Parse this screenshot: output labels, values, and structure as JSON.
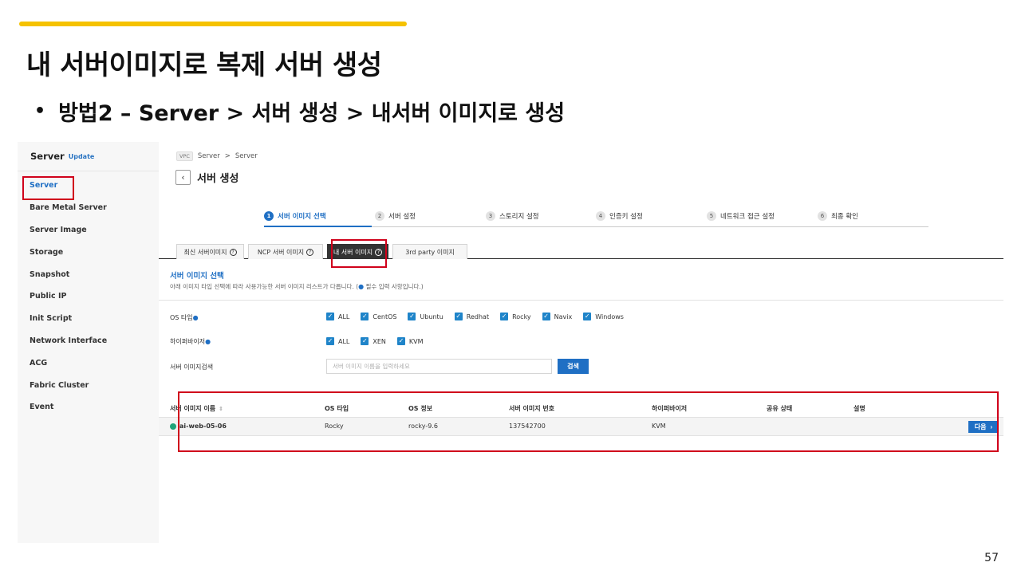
{
  "slide": {
    "title": "내 서버이미지로 복제 서버 생성",
    "bullet": "방법2 – Server > 서버 생성 > 내서버 이미지로 생성",
    "page_number": "57",
    "accent_color": "#f5c200"
  },
  "sidebar": {
    "title": "Server",
    "update_label": "Update",
    "items": [
      {
        "label": "Server",
        "active": true
      },
      {
        "label": "Bare Metal Server",
        "active": false
      },
      {
        "label": "Server Image",
        "active": false
      },
      {
        "label": "Storage",
        "active": false
      },
      {
        "label": "Snapshot",
        "active": false
      },
      {
        "label": "Public IP",
        "active": false
      },
      {
        "label": "Init Script",
        "active": false
      },
      {
        "label": "Network Interface",
        "active": false
      },
      {
        "label": "ACG",
        "active": false
      },
      {
        "label": "Fabric Cluster",
        "active": false
      },
      {
        "label": "Event",
        "active": false
      }
    ]
  },
  "header": {
    "breadcrumb": {
      "tag": "VPC",
      "items": [
        "Server",
        "Server"
      ],
      "separator": ">"
    },
    "back_icon": "chevron-left-icon",
    "title": "서버 생성"
  },
  "stepper": {
    "steps": [
      {
        "num": "1",
        "label": "서버 이미지 선택",
        "active": true
      },
      {
        "num": "2",
        "label": "서버 설정",
        "active": false
      },
      {
        "num": "3",
        "label": "스토리지 설정",
        "active": false
      },
      {
        "num": "4",
        "label": "인증키 설정",
        "active": false
      },
      {
        "num": "5",
        "label": "네트워크 접근 설정",
        "active": false
      },
      {
        "num": "6",
        "label": "최종 확인",
        "active": false
      }
    ]
  },
  "tabs": {
    "items": [
      {
        "label": "최신 서버이미지",
        "active": false
      },
      {
        "label": "NCP 서버 이미지",
        "active": false
      },
      {
        "label": "내 서버 이미지",
        "active": true
      },
      {
        "label": "3rd party 이미지",
        "active": false
      }
    ],
    "help_glyph": "?"
  },
  "section": {
    "title": "서버 이미지 선택",
    "desc_before": "아래 이미지 타입 선택에 따라 사용가능한 서버 이미지 리스트가 다릅니다. (",
    "required_marker": "●",
    "desc_after": " 필수 입력 사항입니다.)"
  },
  "filters": {
    "os_type": {
      "label": "OS 타입",
      "options": [
        "ALL",
        "CentOS",
        "Ubuntu",
        "Redhat",
        "Rocky",
        "Navix",
        "Windows"
      ]
    },
    "hypervisor": {
      "label": "하이퍼바이저",
      "options": [
        "ALL",
        "XEN",
        "KVM"
      ]
    },
    "search": {
      "label": "서버 이미지검색",
      "placeholder": "서버 이미지 이름을 입력하세요",
      "button": "검색"
    },
    "check_glyph": "✓"
  },
  "table": {
    "columns": [
      "서버 이미지 이름",
      "OS 타입",
      "OS 정보",
      "서버 이미지 번호",
      "하이퍼바이저",
      "공유 상태",
      "설명"
    ],
    "sort_glyph": "⇕",
    "rows": [
      {
        "name": "ai-web-05-06",
        "os_type": "Rocky",
        "os_info": "rocky-9.6",
        "image_no": "137542700",
        "hypervisor": "KVM",
        "share_status": "",
        "description": ""
      }
    ],
    "next_button": "다음",
    "next_glyph": "›"
  },
  "colors": {
    "primary": "#1f6fc4",
    "checkbox": "#1f84c9",
    "highlight_box": "#d0021b",
    "status_running": "#21a47a"
  }
}
